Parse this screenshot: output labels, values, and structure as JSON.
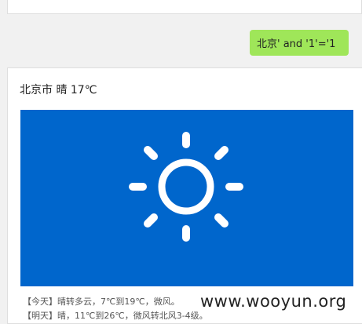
{
  "chat": {
    "user_message": "北京' and '1'='1",
    "reply": {
      "title": "北京市 晴 17℃",
      "weather_icon": "sun-icon",
      "forecast_today": "【今天】晴转多云，7℃到19℃，微风。",
      "forecast_tomorrow": "【明天】晴，11℃到26℃，微风转北风3-4级。"
    }
  },
  "watermark": "www.wooyun.org",
  "colors": {
    "page_background": "#f1f1f1",
    "user_bubble": "#9fe659",
    "weather_panel": "#0066cc",
    "sun": "#ffffff"
  }
}
